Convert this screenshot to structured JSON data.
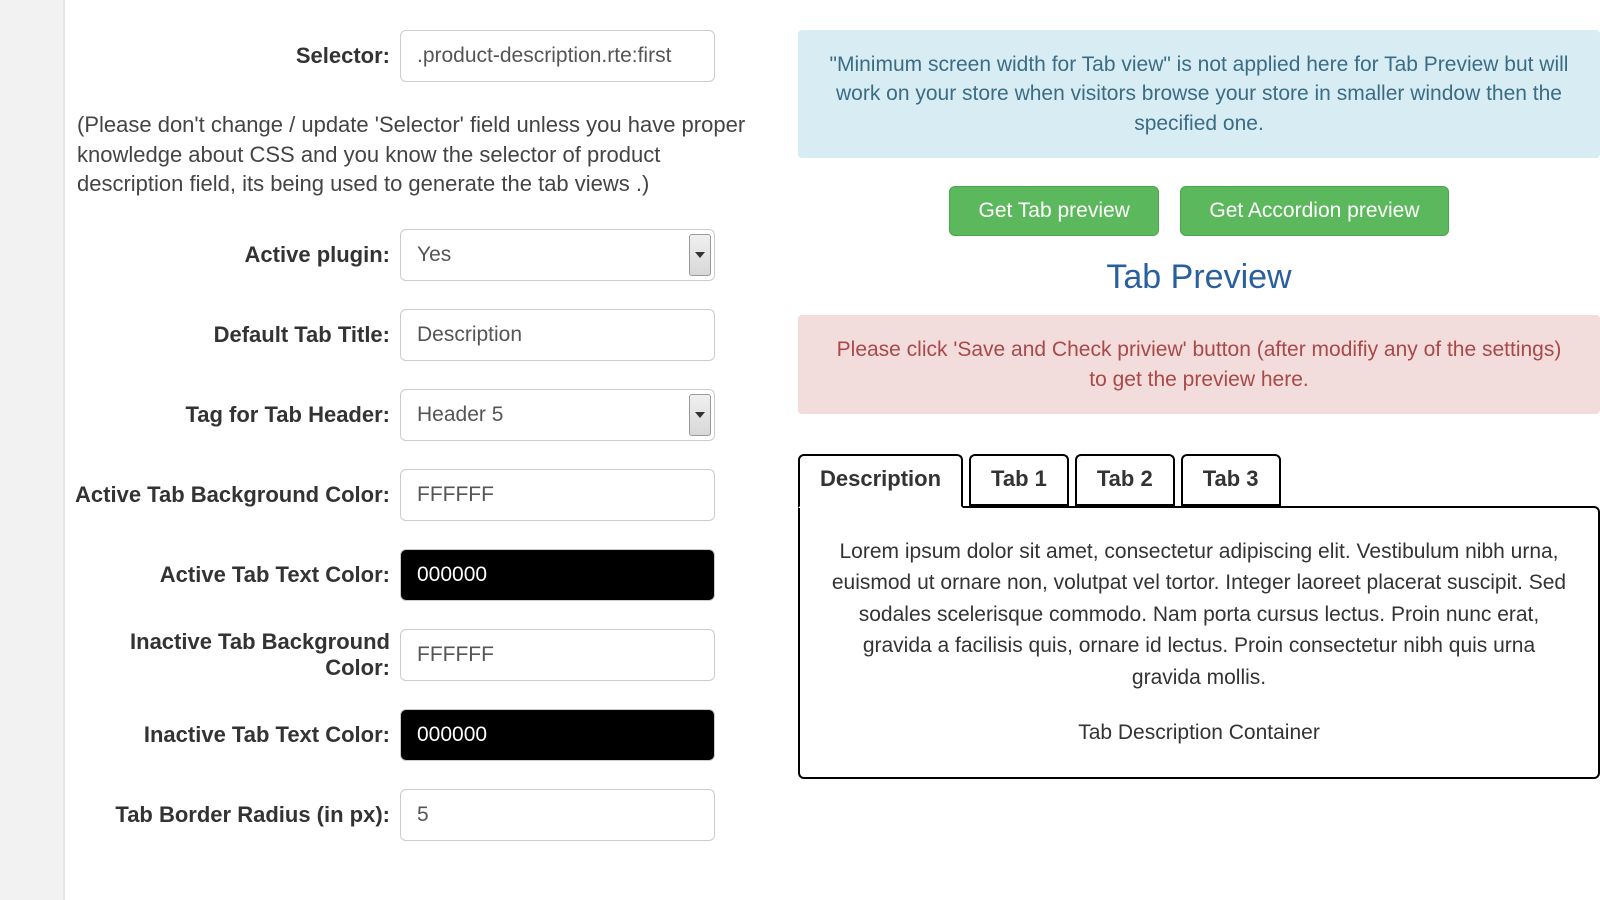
{
  "form": {
    "selector_label": "Selector:",
    "selector_value": ".product-description.rte:first",
    "selector_help": "(Please don't change / update 'Selector' field unless you have proper knowledge about CSS and you know the selector of product description field, its being used to generate the tab views .)",
    "active_plugin_label": "Active plugin:",
    "active_plugin_value": "Yes",
    "default_tab_title_label": "Default Tab Title:",
    "default_tab_title_value": "Description",
    "tag_header_label": "Tag for Tab Header:",
    "tag_header_value": "Header 5",
    "active_bg_label": "Active Tab Background Color:",
    "active_bg_value": "FFFFFF",
    "active_text_label": "Active Tab Text Color:",
    "active_text_value": "000000",
    "inactive_bg_label": "Inactive Tab Background Color:",
    "inactive_bg_value": "FFFFFF",
    "inactive_text_label": "Inactive Tab Text Color:",
    "inactive_text_value": "000000",
    "border_radius_label": "Tab Border Radius (in px):",
    "border_radius_value": "5"
  },
  "preview": {
    "info": "\"Minimum screen width for Tab view\" is not applied here for Tab Preview but will work on your store when visitors browse your store in smaller window then the specified one.",
    "btn_tab": "Get Tab preview",
    "btn_accordion": "Get Accordion preview",
    "title": "Tab Preview",
    "warn": "Please click 'Save and Check priview' button (after modifiy any of the settings) to get the preview here.",
    "tabs": {
      "t0": "Description",
      "t1": "Tab 1",
      "t2": "Tab 2",
      "t3": "Tab 3"
    },
    "lorem": "Lorem ipsum dolor sit amet, consectetur adipiscing elit. Vestibulum nibh urna, euismod ut ornare non, volutpat vel tortor. Integer laoreet placerat suscipit. Sed sodales scelerisque commodo. Nam porta cursus lectus. Proin nunc erat, gravida a facilisis quis, ornare id lectus. Proin consectetur nibh quis urna gravida mollis.",
    "container_label": "Tab Description Container"
  }
}
